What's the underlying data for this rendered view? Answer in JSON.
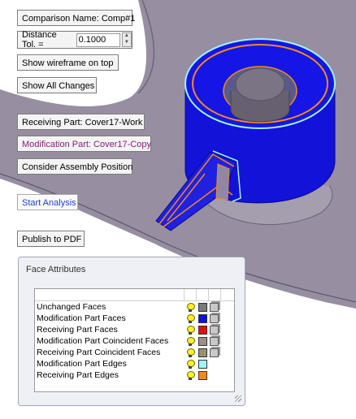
{
  "toolbar": {
    "comparison_name": "Comparison Name: Comp#1",
    "distance_tol_label": "Distance Tol. =",
    "distance_tol_value": "0.1000",
    "show_wireframe": "Show wireframe on top",
    "show_all_changes": "Show All Changes",
    "receiving_part": "Receiving Part: Cover17-Work",
    "modification_part": "Modification Part: Cover17-Copy",
    "consider_assembly": "Consider Assembly Position",
    "start_analysis": "Start Analysis",
    "publish_pdf": "Publish to PDF"
  },
  "face_attributes": {
    "title": "Face Attributes",
    "rows": [
      {
        "label": "Unchanged Faces",
        "color": "#7a7a7a",
        "has_box": true
      },
      {
        "label": "Modification Part Faces",
        "color": "#1010e0",
        "has_box": true
      },
      {
        "label": "Receiving Part Faces",
        "color": "#e01010",
        "has_box": true
      },
      {
        "label": "Modification Part Coincident Faces",
        "color": "#a08c8c",
        "has_box": true
      },
      {
        "label": "Receiving  Part Coincident Faces",
        "color": "#9a9072",
        "has_box": true
      },
      {
        "label": "Modification Part Edges",
        "color": "#a0f4f8",
        "has_box": false
      },
      {
        "label": "Receiving  Part Edges",
        "color": "#f08a20",
        "has_box": false
      }
    ]
  },
  "colors": {
    "part_body": "#9790a2",
    "modification_faces": "#1010e0",
    "receiving_edges": "#f08a20",
    "modification_edges": "#a0f4f8"
  }
}
